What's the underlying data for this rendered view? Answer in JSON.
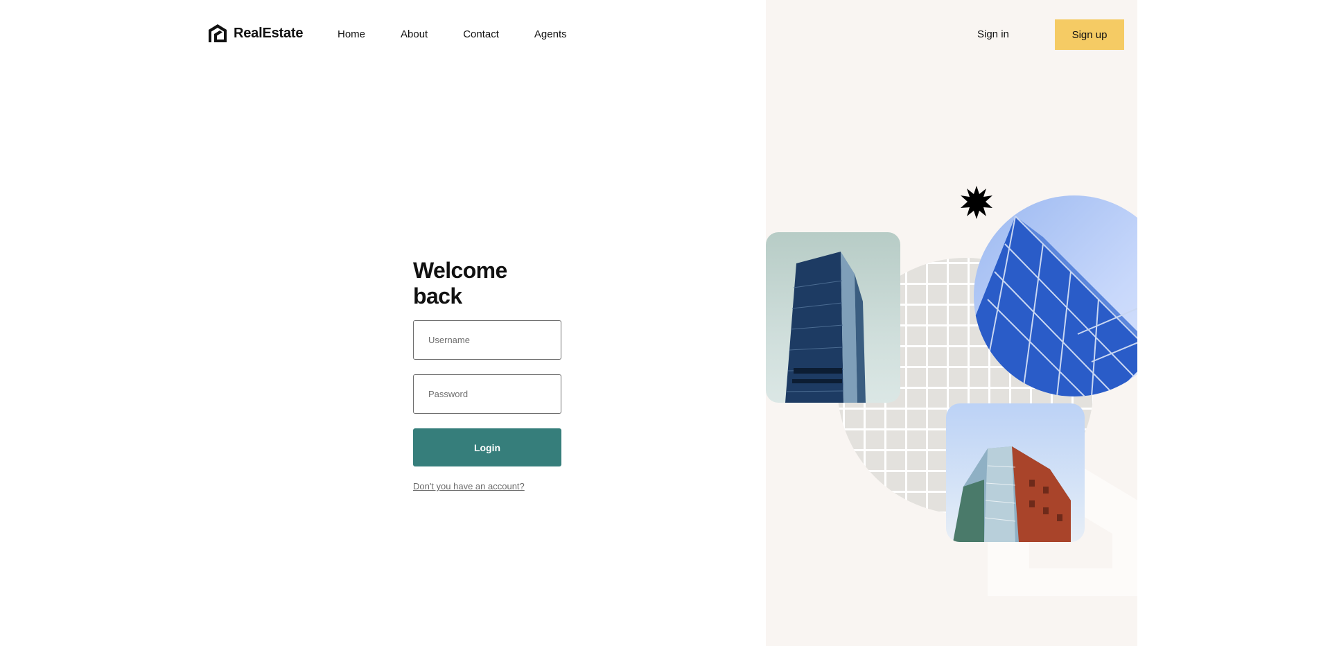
{
  "brand": {
    "name": "RealEstate",
    "icon": "logo-icon"
  },
  "nav": {
    "items": [
      {
        "label": "Home"
      },
      {
        "label": "About"
      },
      {
        "label": "Contact"
      },
      {
        "label": "Agents"
      }
    ]
  },
  "auth": {
    "sign_in": "Sign in",
    "sign_up": "Sign up"
  },
  "login": {
    "title": "Welcome back",
    "username_placeholder": "Username",
    "username_value": "",
    "password_placeholder": "Password",
    "password_value": "",
    "submit_label": "Login",
    "signup_link": "Don't you have an account?"
  },
  "colors": {
    "accent": "#367e7b",
    "signup_bg": "#f5cb64",
    "panel_bg": "#f9f5f2"
  }
}
